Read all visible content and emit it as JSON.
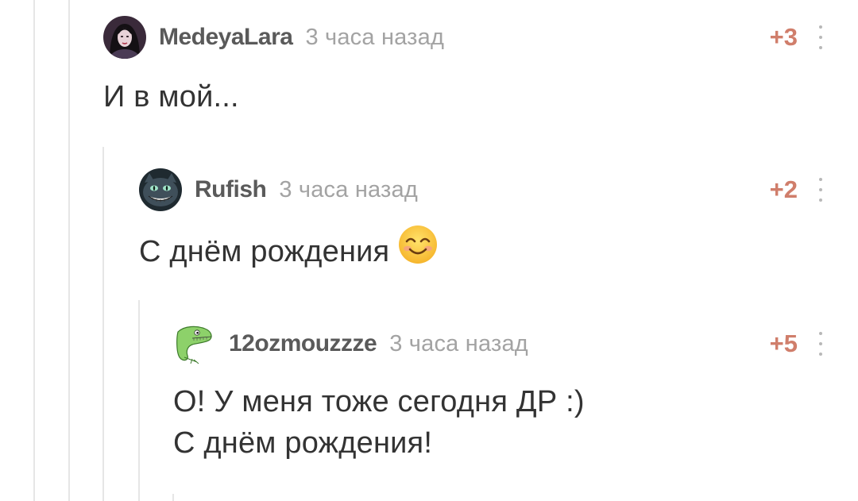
{
  "comments": [
    {
      "author": "MedeyaLara",
      "time": "3 часа назад",
      "rating": "+3",
      "text_lines": [
        "И в мой..."
      ]
    },
    {
      "author": "Rufish",
      "time": "3 часа назад",
      "rating": "+2",
      "text_lines": [
        "С днём рождения"
      ],
      "emoji": "smiling-face-icon"
    },
    {
      "author": "12ozmouzzze",
      "time": "3 часа назад",
      "rating": "+5",
      "text_lines": [
        "О! У меня тоже сегодня ДР :)",
        "С днём рождения!"
      ]
    }
  ],
  "colors": {
    "rating": "#d07e6b",
    "author": "#5a5a5a",
    "time": "#a3a3a3",
    "text": "#333333",
    "thread_line": "#e6e6e6"
  }
}
